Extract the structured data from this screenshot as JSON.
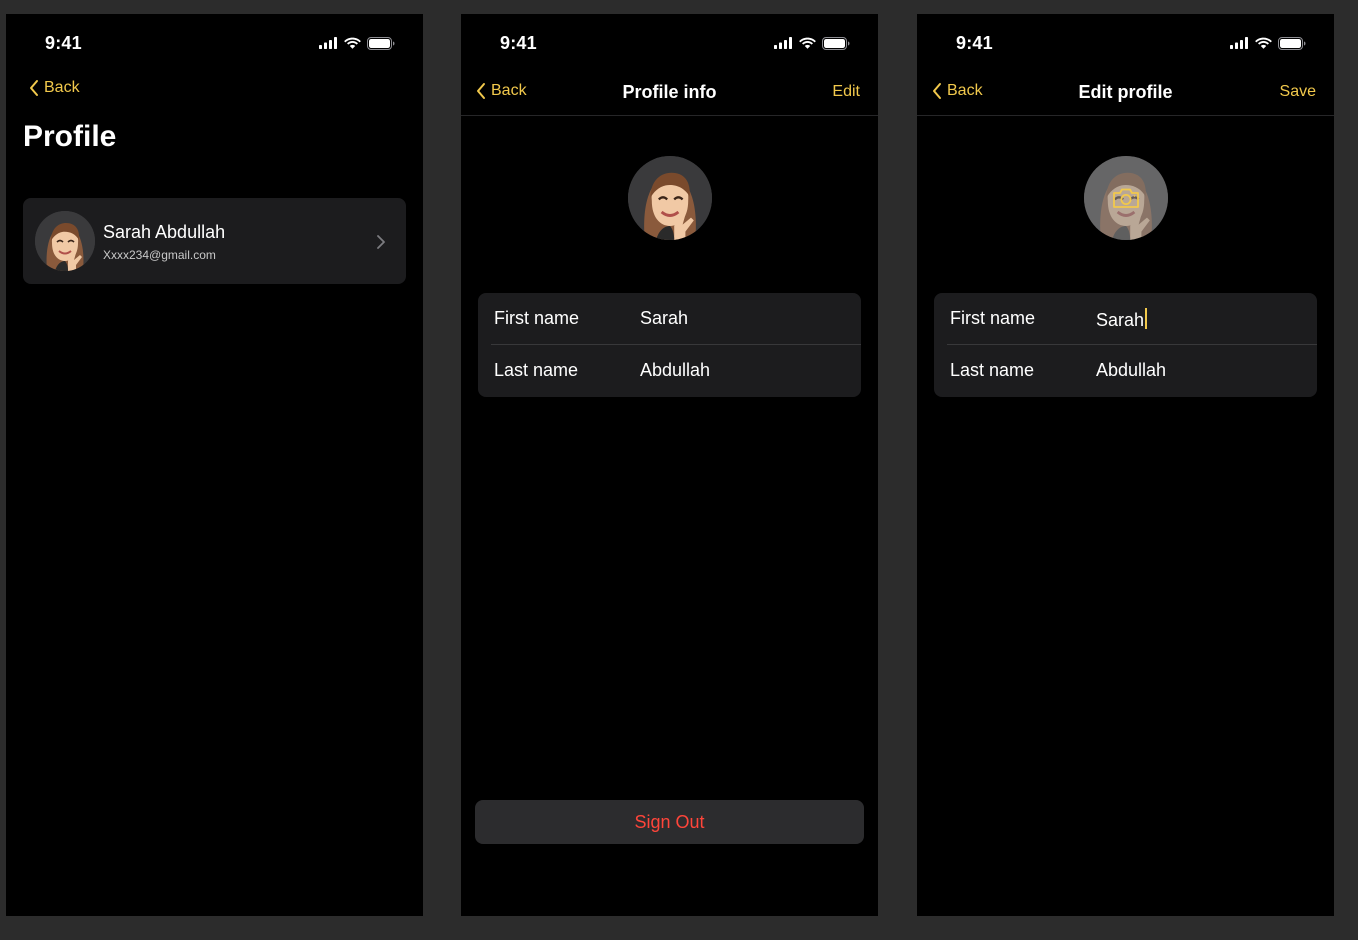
{
  "colors": {
    "accent": "#f2c94c",
    "destructive": "#ff453a",
    "background": "#000000",
    "card": "#1c1c1e",
    "canvas": "#2c2c2c"
  },
  "status_bar": {
    "time": "9:41",
    "icons": [
      "cellular-signal-icon",
      "wifi-icon",
      "battery-icon"
    ]
  },
  "screen_profile": {
    "back_label": "Back",
    "title": "Profile",
    "user_card": {
      "name": "Sarah Abdullah",
      "email": "Xxxx234@gmail.com",
      "avatar": "memoji-avatar-icon",
      "chevron": "chevron-right-icon"
    }
  },
  "screen_profile_info": {
    "back_label": "Back",
    "title": "Profile info",
    "action_label": "Edit",
    "avatar": "memoji-avatar-icon",
    "fields": [
      {
        "label": "First name",
        "value": "Sarah"
      },
      {
        "label": "Last name",
        "value": "Abdullah"
      }
    ],
    "sign_out_label": "Sign Out"
  },
  "screen_edit_profile": {
    "back_label": "Back",
    "title": "Edit profile",
    "action_label": "Save",
    "avatar": "memoji-avatar-icon",
    "avatar_overlay_icon": "camera-icon",
    "fields": [
      {
        "label": "First name",
        "value": "Sarah"
      },
      {
        "label": "Last name",
        "value": "Abdullah"
      }
    ]
  }
}
